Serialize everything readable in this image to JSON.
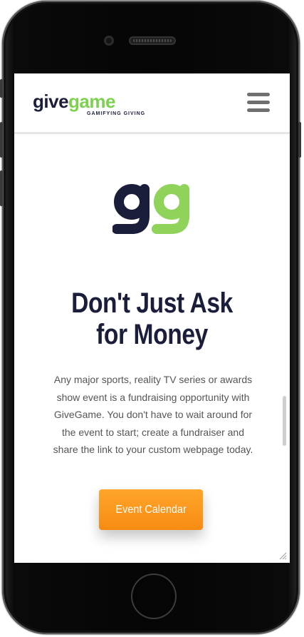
{
  "brand": {
    "give": "give",
    "game": "game",
    "tagline": "GAMIFYING GIVING"
  },
  "hero": {
    "headline_line1": "Don't Just Ask",
    "headline_line2": "for Money",
    "body": "Any major sports, reality TV series or awards show event is a fundraising opportunity with GiveGame. You don't have to wait around for the event to start; create a fundraiser and share the link to your custom webpage today.",
    "cta_label": "Event Calendar"
  },
  "colors": {
    "navy": "#1b1e3b",
    "green": "#7ed14f",
    "cta_orange": "#f78b13"
  },
  "icons": {
    "menu": "hamburger-menu-icon",
    "logo_mark": "gg-logo-icon"
  }
}
